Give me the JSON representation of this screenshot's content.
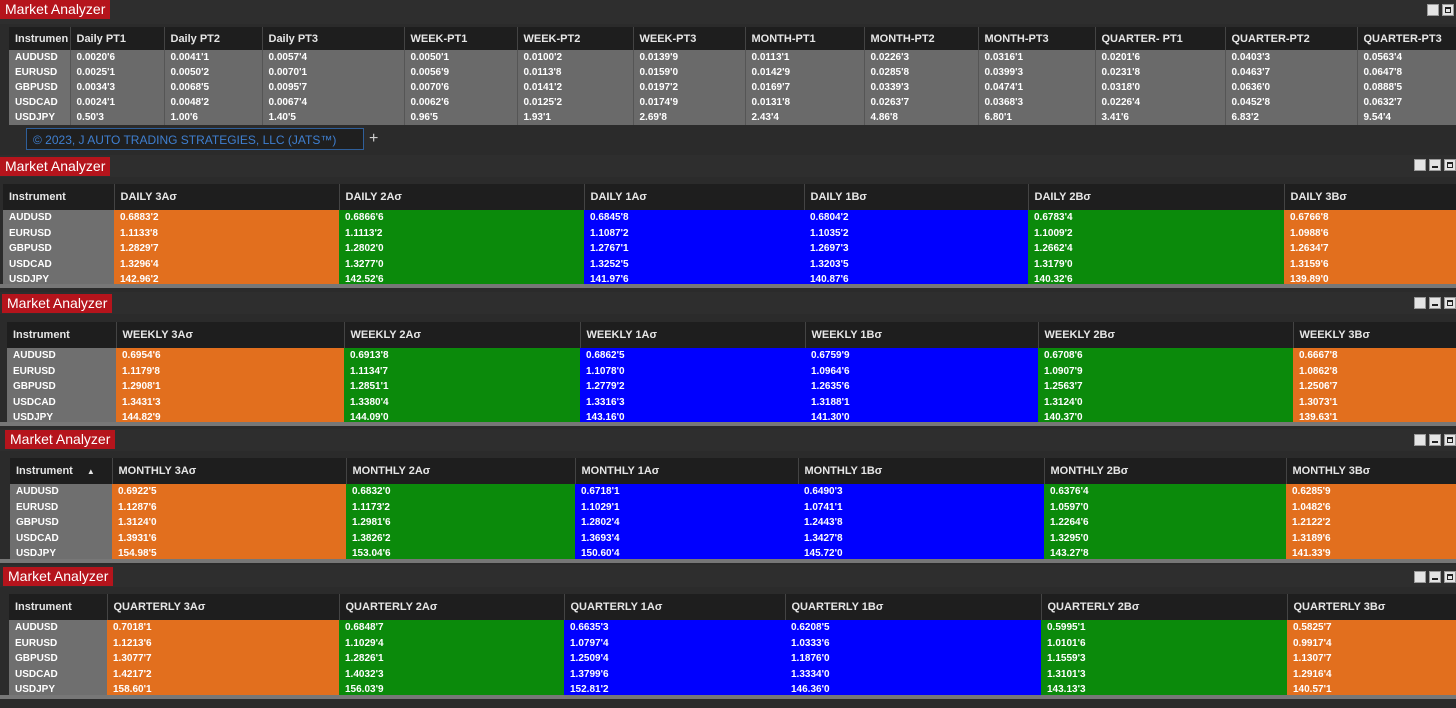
{
  "colors": {
    "orange": "#e26f1e",
    "green": "#0b8a0b",
    "blue": "#0000ff",
    "gray": "#6a6a6a",
    "title_red": "#b5141c"
  },
  "top_panel": {
    "title": "Market Analyzer",
    "columns": [
      "Instrumen",
      "Daily PT1",
      "Daily PT2",
      "Daily PT3",
      "WEEK-PT1",
      "WEEK-PT2",
      "WEEK-PT3",
      "MONTH-PT1",
      "MONTH-PT2",
      "MONTH-PT3",
      "QUARTER- PT1",
      "QUARTER-PT2",
      "QUARTER-PT3"
    ],
    "rows": [
      [
        "AUDUSD",
        "0.0020'6",
        "0.0041'1",
        "0.0057'4",
        "0.0050'1",
        "0.0100'2",
        "0.0139'9",
        "0.0113'1",
        "0.0226'3",
        "0.0316'1",
        "0.0201'6",
        "0.0403'3",
        "0.0563'4"
      ],
      [
        "EURUSD",
        "0.0025'1",
        "0.0050'2",
        "0.0070'1",
        "0.0056'9",
        "0.0113'8",
        "0.0159'0",
        "0.0142'9",
        "0.0285'8",
        "0.0399'3",
        "0.0231'8",
        "0.0463'7",
        "0.0647'8"
      ],
      [
        "GBPUSD",
        "0.0034'3",
        "0.0068'5",
        "0.0095'7",
        "0.0070'6",
        "0.0141'2",
        "0.0197'2",
        "0.0169'7",
        "0.0339'3",
        "0.0474'1",
        "0.0318'0",
        "0.0636'0",
        "0.0888'5"
      ],
      [
        "USDCAD",
        "0.0024'1",
        "0.0048'2",
        "0.0067'4",
        "0.0062'6",
        "0.0125'2",
        "0.0174'9",
        "0.0131'8",
        "0.0263'7",
        "0.0368'3",
        "0.0226'4",
        "0.0452'8",
        "0.0632'7"
      ],
      [
        "USDJPY",
        "0.50'3",
        "1.00'6",
        "1.40'5",
        "0.96'5",
        "1.93'1",
        "2.69'8",
        "2.43'4",
        "4.86'8",
        "6.80'1",
        "3.41'6",
        "6.83'2",
        "9.54'4"
      ]
    ],
    "tab_label": "© 2023, J AUTO TRADING STRATEGIES, LLC (JATS™)",
    "add_tab": "+"
  },
  "daily_panel": {
    "title": "Market Analyzer",
    "columns": [
      "Instrument",
      "DAILY 3Aσ",
      "DAILY 2Aσ",
      "DAILY 1Aσ",
      "DAILY 1Bσ",
      "DAILY 2Bσ",
      "DAILY 3Bσ"
    ],
    "rows": [
      [
        "AUDUSD",
        "0.6883'2",
        "0.6866'6",
        "0.6845'8",
        "0.6804'2",
        "0.6783'4",
        "0.6766'8"
      ],
      [
        "EURUSD",
        "1.1133'8",
        "1.1113'2",
        "1.1087'2",
        "1.1035'2",
        "1.1009'2",
        "1.0988'6"
      ],
      [
        "GBPUSD",
        "1.2829'7",
        "1.2802'0",
        "1.2767'1",
        "1.2697'3",
        "1.2662'4",
        "1.2634'7"
      ],
      [
        "USDCAD",
        "1.3296'4",
        "1.3277'0",
        "1.3252'5",
        "1.3203'5",
        "1.3179'0",
        "1.3159'6"
      ],
      [
        "USDJPY",
        "142.96'2",
        "142.52'6",
        "141.97'6",
        "140.87'6",
        "140.32'6",
        "139.89'0"
      ]
    ]
  },
  "weekly_panel": {
    "title": "Market Analyzer",
    "columns": [
      "Instrument",
      "WEEKLY 3Aσ",
      "WEEKLY 2Aσ",
      "WEEKLY 1Aσ",
      "WEEKLY 1Bσ",
      "WEEKLY 2Bσ",
      "WEEKLY 3Bσ"
    ],
    "rows": [
      [
        "AUDUSD",
        "0.6954'6",
        "0.6913'8",
        "0.6862'5",
        "0.6759'9",
        "0.6708'6",
        "0.6667'8"
      ],
      [
        "EURUSD",
        "1.1179'8",
        "1.1134'7",
        "1.1078'0",
        "1.0964'6",
        "1.0907'9",
        "1.0862'8"
      ],
      [
        "GBPUSD",
        "1.2908'1",
        "1.2851'1",
        "1.2779'2",
        "1.2635'6",
        "1.2563'7",
        "1.2506'7"
      ],
      [
        "USDCAD",
        "1.3431'3",
        "1.3380'4",
        "1.3316'3",
        "1.3188'1",
        "1.3124'0",
        "1.3073'1"
      ],
      [
        "USDJPY",
        "144.82'9",
        "144.09'0",
        "143.16'0",
        "141.30'0",
        "140.37'0",
        "139.63'1"
      ]
    ]
  },
  "monthly_panel": {
    "title": "Market Analyzer",
    "columns": [
      "Instrument",
      "MONTHLY 3Aσ",
      "MONTHLY 2Aσ",
      "MONTHLY 1Aσ",
      "MONTHLY 1Bσ",
      "MONTHLY 2Bσ",
      "MONTHLY 3Bσ"
    ],
    "rows": [
      [
        "AUDUSD",
        "0.6922'5",
        "0.6832'0",
        "0.6718'1",
        "0.6490'3",
        "0.6376'4",
        "0.6285'9"
      ],
      [
        "EURUSD",
        "1.1287'6",
        "1.1173'2",
        "1.1029'1",
        "1.0741'1",
        "1.0597'0",
        "1.0482'6"
      ],
      [
        "GBPUSD",
        "1.3124'0",
        "1.2981'6",
        "1.2802'4",
        "1.2443'8",
        "1.2264'6",
        "1.2122'2"
      ],
      [
        "USDCAD",
        "1.3931'6",
        "1.3826'2",
        "1.3693'4",
        "1.3427'8",
        "1.3295'0",
        "1.3189'6"
      ],
      [
        "USDJPY",
        "154.98'5",
        "153.04'6",
        "150.60'4",
        "145.72'0",
        "143.27'8",
        "141.33'9"
      ]
    ]
  },
  "quarterly_panel": {
    "title": "Market Analyzer",
    "columns": [
      "Instrument",
      "QUARTERLY 3Aσ",
      "QUARTERLY 2Aσ",
      "QUARTERLY 1Aσ",
      "QUARTERLY 1Bσ",
      "QUARTERLY 2Bσ",
      "QUARTERLY 3Bσ"
    ],
    "rows": [
      [
        "AUDUSD",
        "0.7018'1",
        "0.6848'7",
        "0.6635'3",
        "0.6208'5",
        "0.5995'1",
        "0.5825'7"
      ],
      [
        "EURUSD",
        "1.1213'6",
        "1.1029'4",
        "1.0797'4",
        "1.0333'6",
        "1.0101'6",
        "0.9917'4"
      ],
      [
        "GBPUSD",
        "1.3077'7",
        "1.2826'1",
        "1.2509'4",
        "1.1876'0",
        "1.1559'3",
        "1.1307'7"
      ],
      [
        "USDCAD",
        "1.4217'2",
        "1.4032'3",
        "1.3799'6",
        "1.3334'0",
        "1.3101'3",
        "1.2916'4"
      ],
      [
        "USDJPY",
        "158.60'1",
        "156.03'9",
        "152.81'2",
        "146.36'0",
        "143.13'3",
        "140.57'1"
      ]
    ]
  }
}
